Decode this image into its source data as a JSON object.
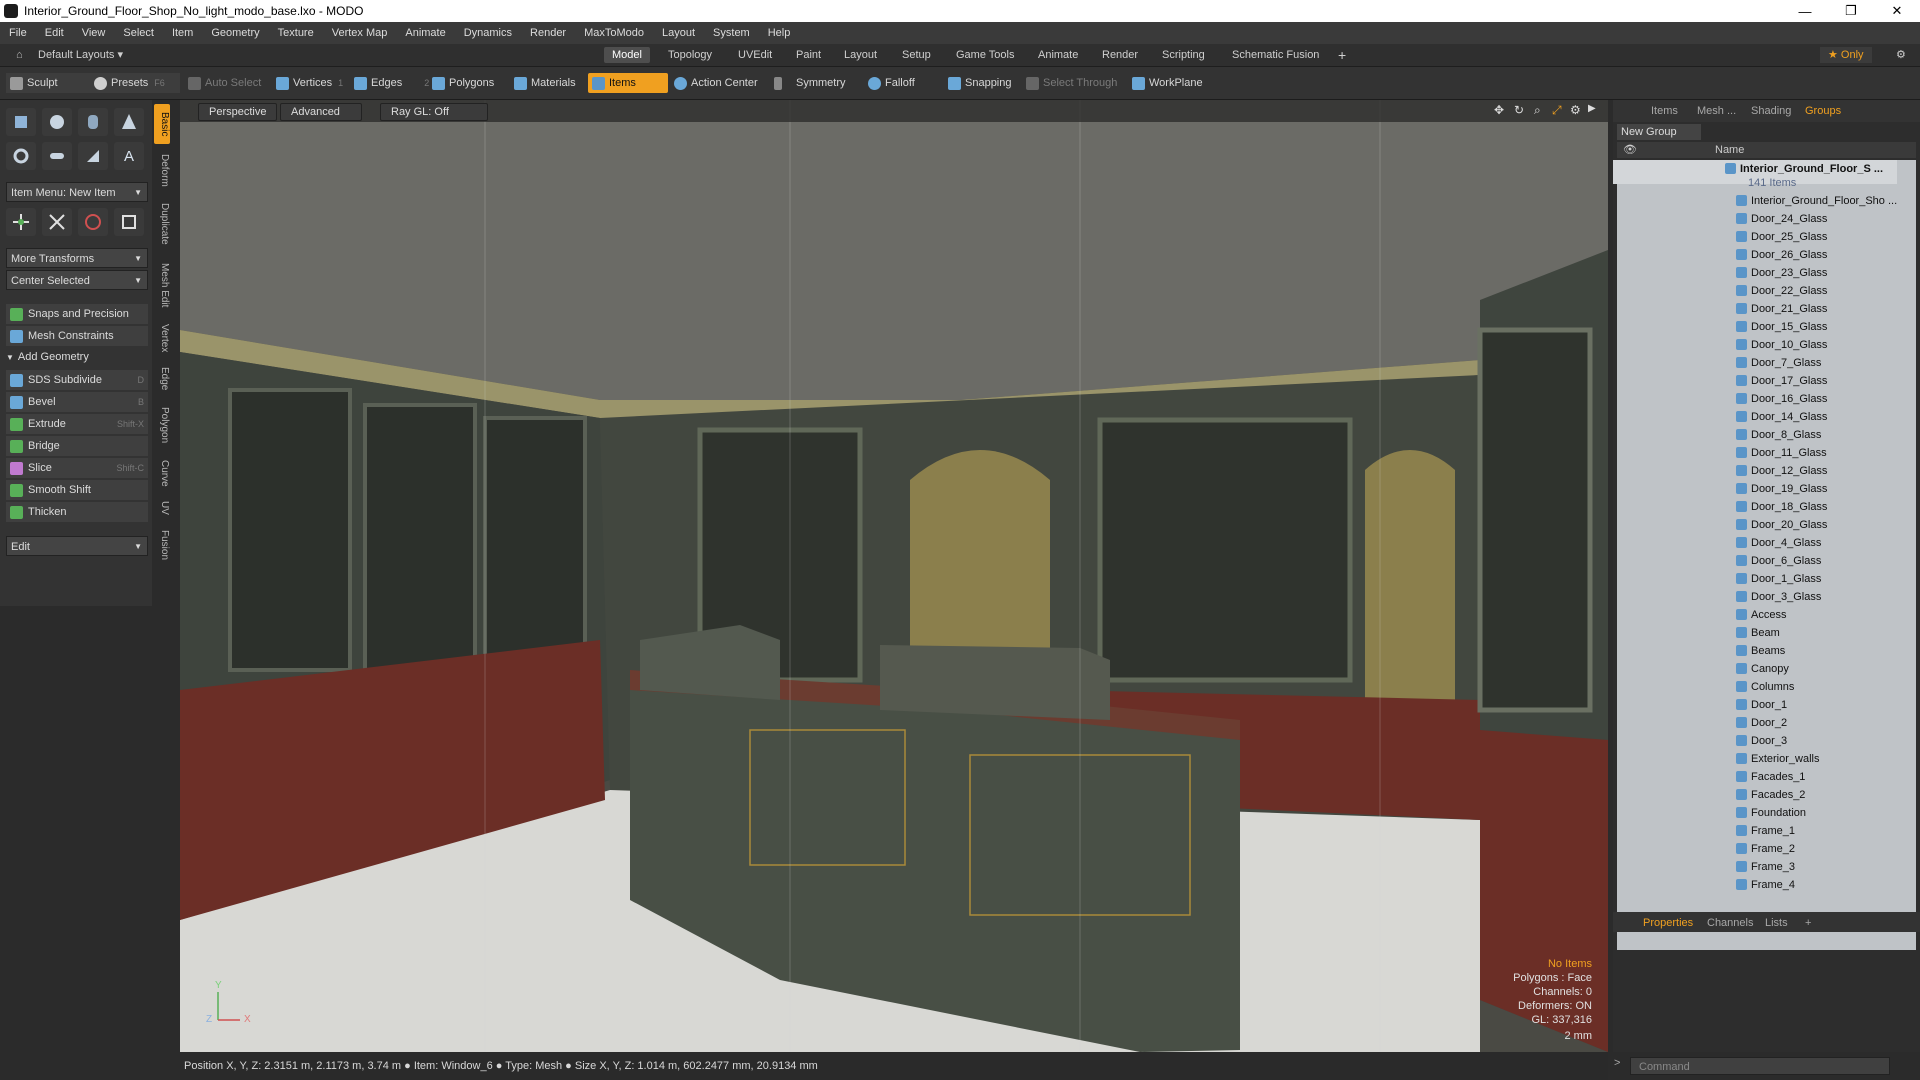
{
  "window": {
    "title": "Interior_Ground_Floor_Shop_No_light_modo_base.lxo - MODO",
    "minimize": "—",
    "maximize": "❐",
    "close": "✕"
  },
  "menu": [
    "File",
    "Edit",
    "View",
    "Select",
    "Item",
    "Geometry",
    "Texture",
    "Vertex Map",
    "Animate",
    "Dynamics",
    "Render",
    "MaxToModo",
    "Layout",
    "System",
    "Help"
  ],
  "layouts": {
    "preset": "Default Layouts ▾",
    "tabs": [
      "Model",
      "Topology",
      "UVEdit",
      "Paint",
      "Layout",
      "Setup",
      "Game Tools",
      "Animate",
      "Render",
      "Scripting",
      "Schematic Fusion"
    ],
    "add": "+",
    "only": "★ Only"
  },
  "toolbar": {
    "sculpt": "Sculpt",
    "presets": "Presets",
    "presets_key": "F6",
    "auto_select": "Auto Select",
    "vertices": "Vertices",
    "vertices_key": "1",
    "edges": "Edges",
    "edges_key": "2",
    "polygons": "Polygons",
    "materials": "Materials",
    "items": "Items",
    "action_center": "Action Center",
    "symmetry": "Symmetry",
    "falloff": "Falloff",
    "snapping": "Snapping",
    "select_through": "Select Through",
    "workplane": "WorkPlane"
  },
  "left_panel": {
    "item_menu": "Item Menu: New Item",
    "more_transforms": "More Transforms",
    "center_selected": "Center Selected",
    "snaps": "Snaps and Precision",
    "mesh_constraints": "Mesh Constraints",
    "add_geometry": "Add Geometry",
    "tools": [
      {
        "label": "SDS Subdivide",
        "key": "D"
      },
      {
        "label": "Bevel",
        "key": "B"
      },
      {
        "label": "Extrude",
        "key": "Shift-X"
      },
      {
        "label": "Bridge",
        "key": ""
      },
      {
        "label": "Slice",
        "key": "Shift-C"
      },
      {
        "label": "Smooth Shift",
        "key": ""
      },
      {
        "label": "Thicken",
        "key": ""
      }
    ],
    "edit": "Edit",
    "vertical_tabs": [
      "Basic",
      "Deform",
      "Duplicate",
      "Mesh Edit",
      "Vertex",
      "Edge",
      "Polygon",
      "Curve",
      "UV",
      "Fusion"
    ]
  },
  "viewport": {
    "view": "Perspective",
    "shading": "Advanced",
    "raygl": "Ray GL: Off",
    "hud": [
      "No Items",
      "Polygons : Face",
      "Channels: 0",
      "Deformers: ON",
      "GL: 337,316",
      "2 mm"
    ],
    "axis_y": "Y",
    "axis_z": "Z",
    "axis_x": "X"
  },
  "status": "Position X, Y, Z:   2.3151 m, 2.1173 m, 3.74 m ● Item:  Window_6 ● Type:  Mesh ● Size X, Y, Z:   1.014 m, 602.2477 mm, 20.9134 mm",
  "right_panel": {
    "tabs": [
      "Items",
      "Mesh ...",
      "Shading",
      "Groups"
    ],
    "new_group": "New Group",
    "col_name": "Name",
    "group_title": "Interior_Ground_Floor_S ...",
    "group_count": "141 Items",
    "groups": [
      "Interior_Ground_Floor_Sho ...",
      "Door_24_Glass",
      "Door_25_Glass",
      "Door_26_Glass",
      "Door_23_Glass",
      "Door_22_Glass",
      "Door_21_Glass",
      "Door_15_Glass",
      "Door_10_Glass",
      "Door_7_Glass",
      "Door_17_Glass",
      "Door_16_Glass",
      "Door_14_Glass",
      "Door_8_Glass",
      "Door_11_Glass",
      "Door_12_Glass",
      "Door_19_Glass",
      "Door_18_Glass",
      "Door_20_Glass",
      "Door_4_Glass",
      "Door_6_Glass",
      "Door_1_Glass",
      "Door_3_Glass",
      "Access",
      "Beam",
      "Beams",
      "Canopy",
      "Columns",
      "Door_1",
      "Door_2",
      "Door_3",
      "Exterior_walls",
      "Facades_1",
      "Facades_2",
      "Foundation",
      "Frame_1",
      "Frame_2",
      "Frame_3",
      "Frame_4"
    ],
    "bottom_tabs": [
      "Properties",
      "Channels",
      "Lists",
      "+"
    ],
    "command_placeholder": "Command"
  }
}
